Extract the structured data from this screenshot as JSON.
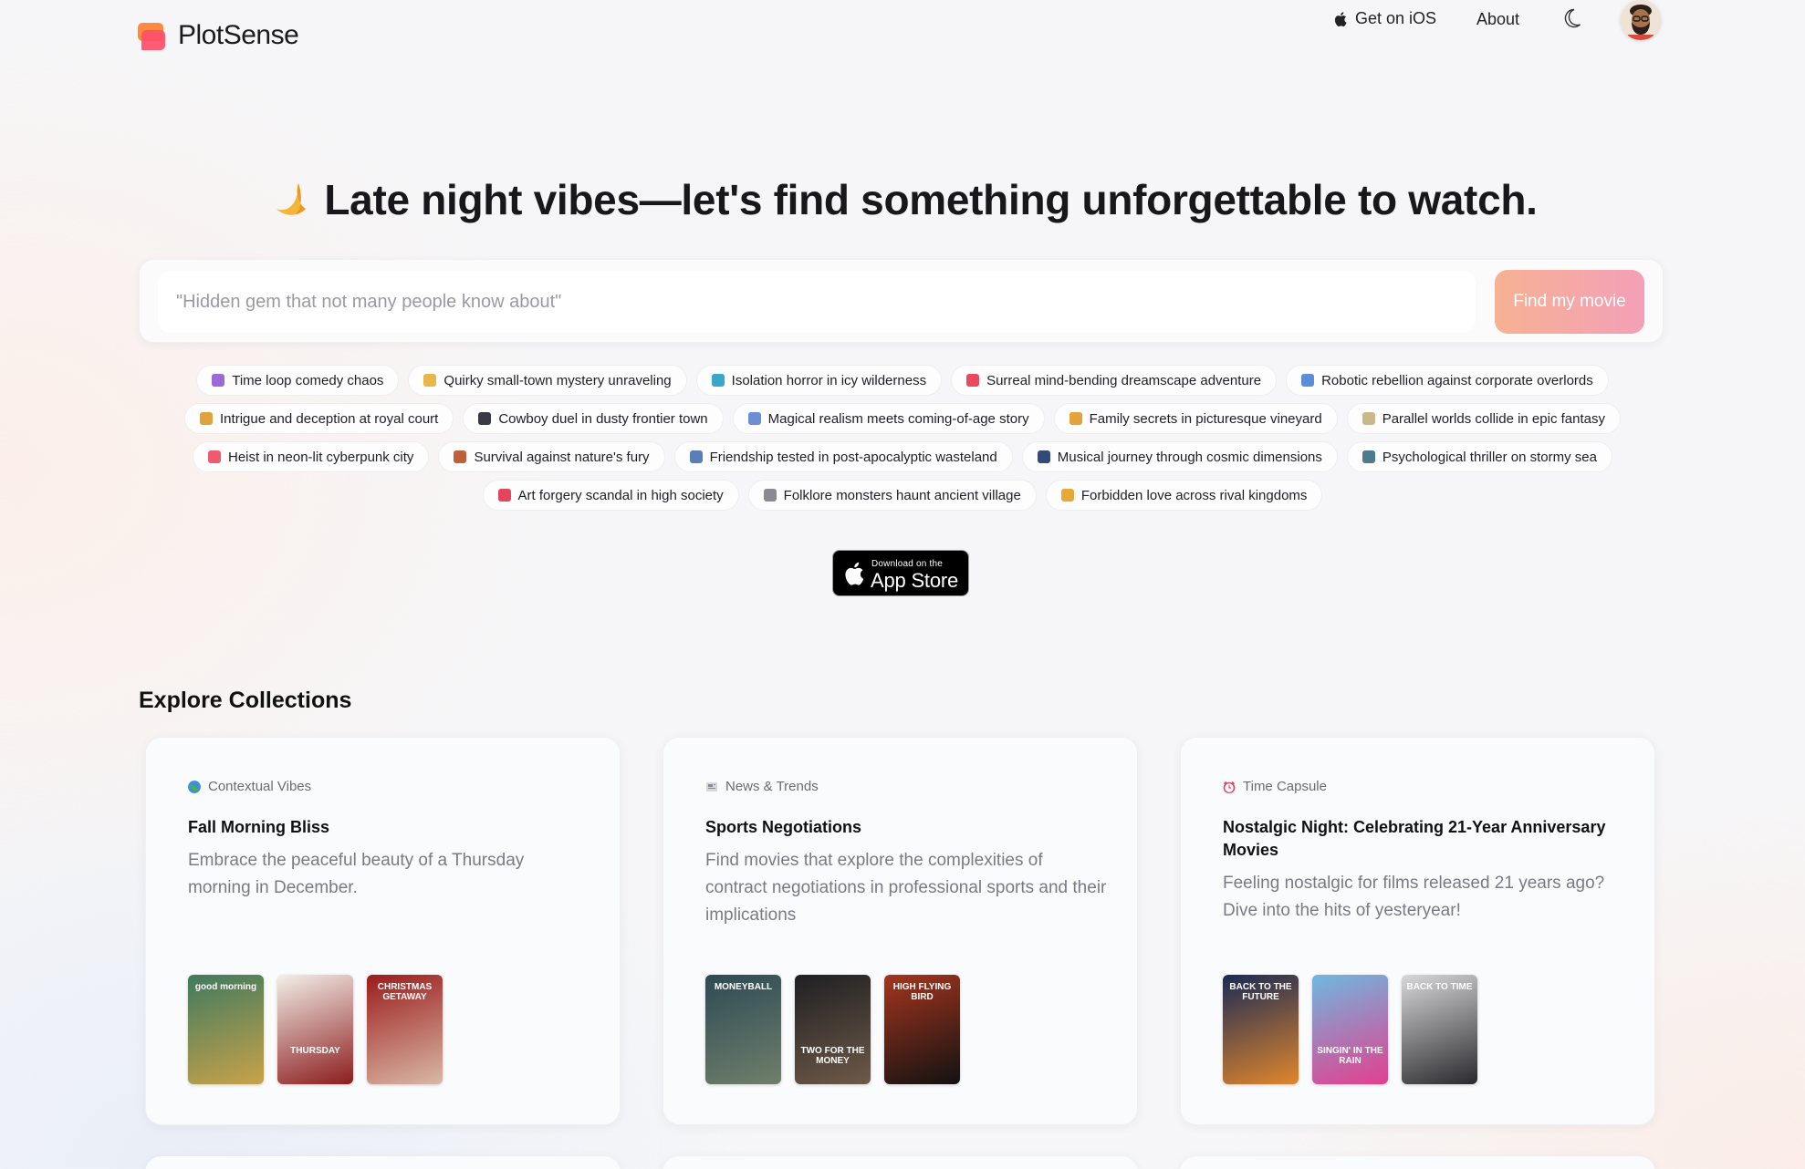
{
  "header": {
    "brand": {
      "plot": "Plot",
      "sense": "Sense"
    },
    "nav": {
      "ios_label": "Get on iOS",
      "about_label": "About"
    }
  },
  "hero": {
    "emoji": "crescent-moon-icon",
    "title": "Late night vibes—let's find something unforgettable to watch."
  },
  "search": {
    "placeholder": "\"Hidden gem that not many people know about\"",
    "value": "",
    "button_label": "Find my movie"
  },
  "suggestions": [
    [
      {
        "label": "Time loop comedy chaos",
        "color": "#9b6ad6"
      },
      {
        "label": "Quirky small-town mystery unraveling",
        "color": "#e9b64a"
      },
      {
        "label": "Isolation horror in icy wilderness",
        "color": "#3aa6c9"
      },
      {
        "label": "Surreal mind-bending dreamscape adventure",
        "color": "#e84a5f"
      },
      {
        "label": "Robotic rebellion against corporate overlords",
        "color": "#5b8dd9"
      }
    ],
    [
      {
        "label": "Intrigue and deception at royal court",
        "color": "#e0a43c"
      },
      {
        "label": "Cowboy duel in dusty frontier town",
        "color": "#3a3a46"
      },
      {
        "label": "Magical realism meets coming-of-age story",
        "color": "#6b8fd6"
      },
      {
        "label": "Family secrets in picturesque vineyard",
        "color": "#e3a23a"
      },
      {
        "label": "Parallel worlds collide in epic fantasy",
        "color": "#c9b98a"
      }
    ],
    [
      {
        "label": "Heist in neon-lit cyberpunk city",
        "color": "#ef5a6f"
      },
      {
        "label": "Survival against nature's fury",
        "color": "#c0603a"
      },
      {
        "label": "Friendship tested in post-apocalyptic wasteland",
        "color": "#5a7fb8"
      },
      {
        "label": "Musical journey through cosmic dimensions",
        "color": "#324a7a"
      },
      {
        "label": "Psychological thriller on stormy sea",
        "color": "#4f7a8e"
      }
    ],
    [
      {
        "label": "Art forgery scandal in high society",
        "color": "#e2455c"
      },
      {
        "label": "Folklore monsters haunt ancient village",
        "color": "#8a8a92"
      },
      {
        "label": "Forbidden love across rival kingdoms",
        "color": "#e8a83a"
      }
    ]
  ],
  "app_store": {
    "small": "Download on the",
    "big": "App Store"
  },
  "collections": {
    "title": "Explore Collections",
    "cards": [
      {
        "category": "Contextual Vibes",
        "category_icon": "globe-icon",
        "title": "Fall Morning Bliss",
        "description": "Embrace the peaceful beauty of a Thursday morning in December.",
        "posters": [
          {
            "text": "good morning",
            "colors": [
              "#3f7a5e",
              "#c9a24a"
            ]
          },
          {
            "text": "THURSDAY",
            "colors": [
              "#f3efe9",
              "#8c1d1d"
            ]
          },
          {
            "text": "CHRISTMAS GETAWAY",
            "colors": [
              "#9b1c1c",
              "#d9b8a6"
            ]
          }
        ]
      },
      {
        "category": "News & Trends",
        "category_icon": "newspaper-icon",
        "title": "Sports Negotiations",
        "description": "Find movies that explore the complexities of contract negotiations in professional sports and their implications",
        "posters": [
          {
            "text": "MONEYBALL",
            "colors": [
              "#2d4a55",
              "#6f7f6a"
            ]
          },
          {
            "text": "TWO FOR THE MONEY",
            "colors": [
              "#1f1f22",
              "#6e5a48"
            ]
          },
          {
            "text": "HIGH FLYING BIRD",
            "colors": [
              "#a5351e",
              "#121212"
            ]
          }
        ]
      },
      {
        "category": "Time Capsule",
        "category_icon": "alarm-clock-icon",
        "title": "Nostalgic Night: Celebrating 21-Year Anniversary Movies",
        "description": "Feeling nostalgic for films released 21 years ago? Dive into the hits of yesteryear!",
        "posters": [
          {
            "text": "BACK TO THE FUTURE",
            "colors": [
              "#1b2a55",
              "#e0862c"
            ]
          },
          {
            "text": "SINGIN' IN THE RAIN",
            "colors": [
              "#6fb8e0",
              "#e33f8d"
            ]
          },
          {
            "text": "BACK TO TIME",
            "colors": [
              "#d8d8da",
              "#2a2a2e"
            ]
          }
        ]
      }
    ]
  }
}
